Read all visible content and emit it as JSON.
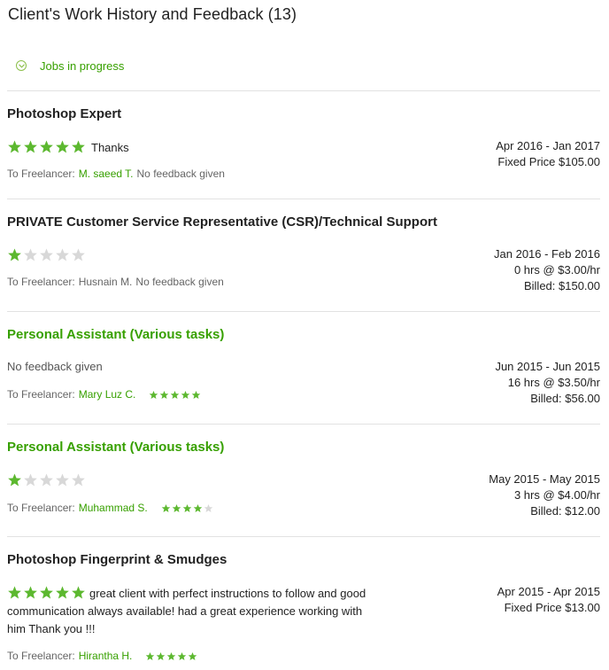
{
  "page_title": "Client's Work History and Feedback (13)",
  "jobs_in_progress_label": "Jobs in progress",
  "colors": {
    "accent_green": "#37a000",
    "star_green": "#5cb82f",
    "star_empty": "#d8d8d8",
    "divider": "#e2e2e2"
  },
  "jobs": [
    {
      "title": "Photoshop Expert",
      "title_is_link": false,
      "client_rating": 5,
      "client_feedback": "Thanks",
      "freelancer_prefix": "To Freelancer:",
      "freelancer_name": "M. saeed T.",
      "freelancer_feedback": "No feedback given",
      "freelancer_rating": null,
      "dates": "Apr 2016 - Jan 2017",
      "rate": "Fixed Price $105.00",
      "billed": ""
    },
    {
      "title": "PRIVATE Customer Service Representative (CSR)/Technical Support",
      "title_is_link": false,
      "client_rating": 1,
      "client_feedback": "",
      "freelancer_prefix": "To Freelancer:",
      "freelancer_name": "Husnain M.",
      "freelancer_feedback": "No feedback given",
      "freelancer_rating": null,
      "dates": "Jan 2016 - Feb 2016",
      "rate": "0 hrs @ $3.00/hr",
      "billed": "Billed: $150.00"
    },
    {
      "title": "Personal Assistant (Various tasks)",
      "title_is_link": true,
      "client_rating": null,
      "client_feedback": "No feedback given",
      "freelancer_prefix": "To Freelancer:",
      "freelancer_name": "Mary Luz C.",
      "freelancer_feedback": "",
      "freelancer_rating": 5,
      "dates": "Jun 2015 - Jun 2015",
      "rate": "16 hrs @ $3.50/hr",
      "billed": "Billed: $56.00"
    },
    {
      "title": "Personal Assistant (Various tasks)",
      "title_is_link": true,
      "client_rating": 1,
      "client_feedback": "",
      "freelancer_prefix": "To Freelancer:",
      "freelancer_name": "Muhammad S.",
      "freelancer_feedback": "",
      "freelancer_rating": 4,
      "dates": "May 2015 - May 2015",
      "rate": "3 hrs @ $4.00/hr",
      "billed": "Billed: $12.00"
    },
    {
      "title": "Photoshop Fingerprint & Smudges",
      "title_is_link": false,
      "client_rating": 5,
      "client_feedback": "great client with perfect instructions to follow and good communication always available! had a great experience working with him Thank you !!!",
      "freelancer_prefix": "To Freelancer:",
      "freelancer_name": "Hirantha H.",
      "freelancer_feedback": "",
      "freelancer_rating": 5,
      "dates": "Apr 2015 - Apr 2015",
      "rate": "Fixed Price $13.00",
      "billed": ""
    }
  ]
}
